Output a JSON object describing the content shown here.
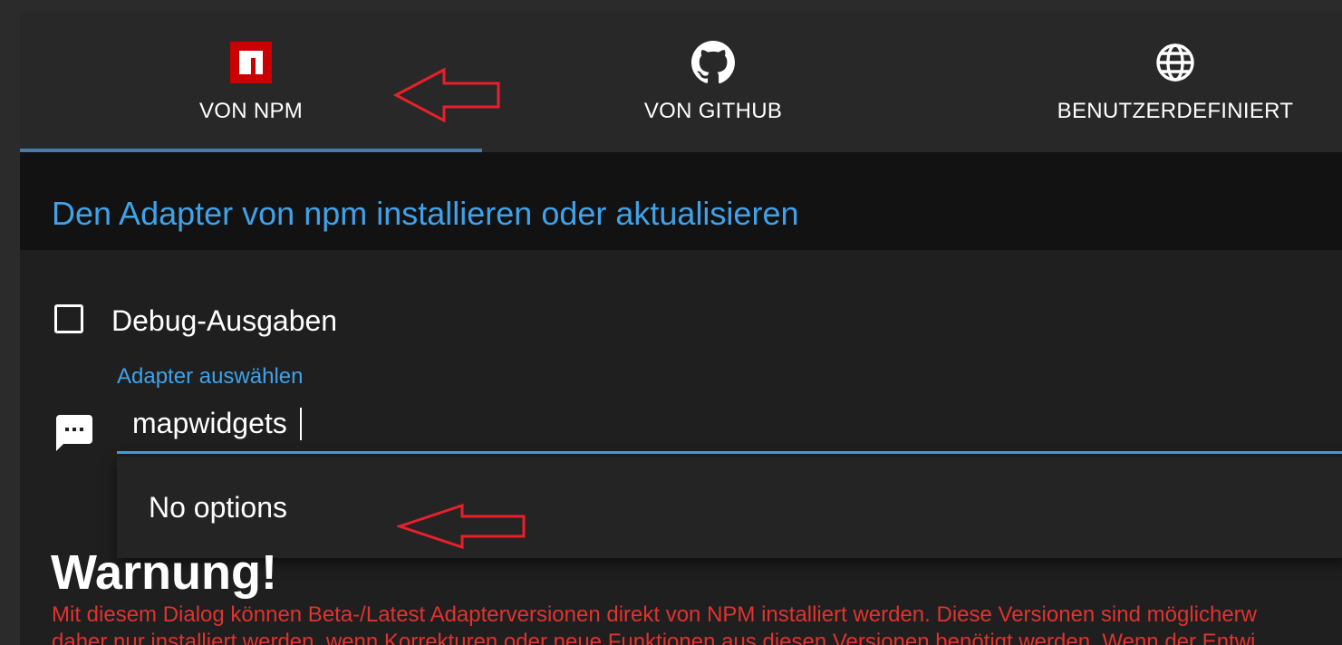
{
  "tabs": [
    {
      "label": "VON NPM",
      "icon": "npm-icon",
      "active": true
    },
    {
      "label": "VON GITHUB",
      "icon": "github-icon",
      "active": false
    },
    {
      "label": "BENUTZERDEFINIERT",
      "icon": "globe-icon",
      "active": false
    }
  ],
  "section_title": "Den Adapter von npm installieren oder aktualisieren",
  "debug": {
    "label": "Debug-Ausgaben",
    "checked": false
  },
  "select": {
    "label": "Adapter auswählen",
    "value": "mapwidgets",
    "no_options": "No options"
  },
  "warning": {
    "title": "Warnung!",
    "line1": "Mit diesem Dialog können Beta-/Latest Adapterversionen direkt von NPM installiert werden. Diese Versionen sind möglicherw",
    "line2": "daher nur installiert werden, wenn Korrekturen oder neue Funktionen aus diesen Versionen benötigt werden. Wenn der Entwi"
  },
  "colors": {
    "accent": "#3fa2ea",
    "tab_indicator": "#4a78a8",
    "warning": "#e0332f",
    "npm_red": "#cb0000",
    "annotation_arrow": "#e8202a"
  }
}
